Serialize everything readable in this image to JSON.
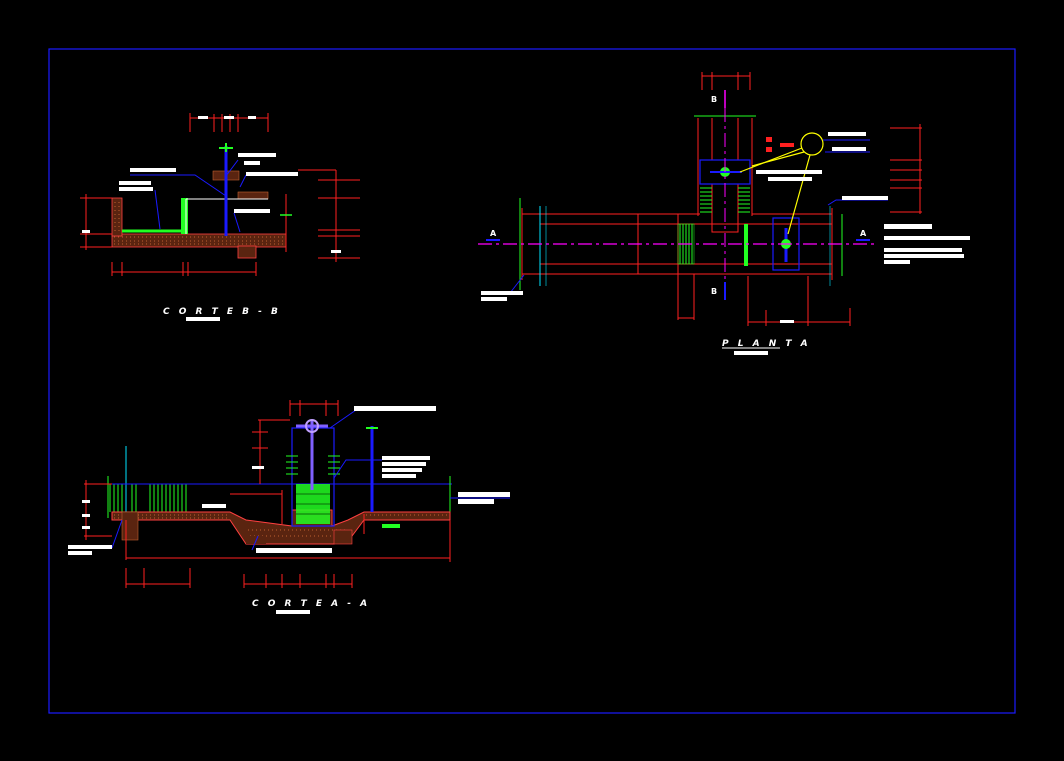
{
  "drawing": {
    "colors": {
      "background": "#000000",
      "frame": "#1a1aff",
      "dimension": "#ff2020",
      "structure": "#ffffff",
      "water": "#1a1aff",
      "accent_green": "#22ff22",
      "accent_cyan": "#00e5ff",
      "axis": "#ff00ff",
      "leader": "#ffff00",
      "soil": "#8b3a1a"
    },
    "views": {
      "corte_bb": {
        "title": "C O R T E   B - B"
      },
      "planta": {
        "title": "P L A N T A",
        "marker_a": "A",
        "marker_b": "B"
      },
      "corte_aa": {
        "title": "C O R T E   A - A"
      }
    }
  }
}
